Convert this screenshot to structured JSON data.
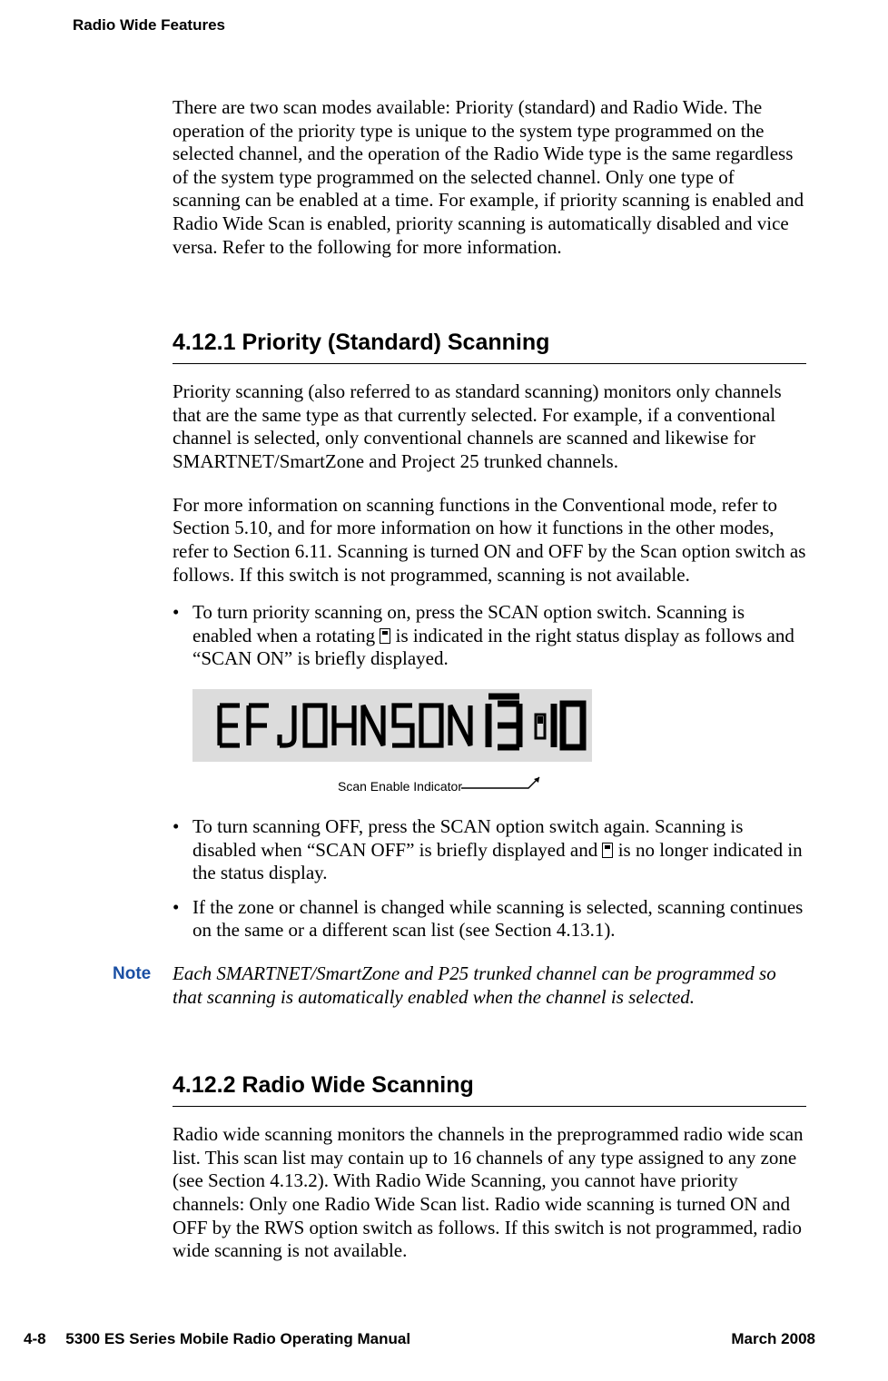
{
  "header": {
    "running": "Radio Wide Features"
  },
  "intro": {
    "p1": "There are two scan modes available: Priority (standard) and Radio Wide. The operation of the priority type is unique to the system type programmed on the selected channel, and the operation of the Radio Wide type is the same regardless of the system type programmed on the selected channel. Only one type of scanning can be enabled at a time. For example, if priority scanning is enabled and Radio Wide Scan is enabled, priority scanning is automatically disabled and vice versa. Refer to the following for more information."
  },
  "s4121": {
    "heading": "4.12.1   Priority (Standard) Scanning",
    "p1": "Priority scanning (also referred to as standard scanning) monitors only channels that are the same type as that currently selected. For example, if a conventional channel is selected, only conventional channels are scanned and likewise for SMARTNET/SmartZone and Project 25 trunked channels.",
    "p2": "For more information on scanning functions in the Conventional mode, refer to Section 5.10, and for more information on how it functions in the other modes, refer to Section 6.11. Scanning is turned ON and OFF by the Scan option switch as follows. If this switch is not programmed, scanning is not available.",
    "bullets": {
      "b1a": "To turn priority scanning on, press the SCAN option switch. Scanning is enabled when a rotating ",
      "b1b": " is indicated in the right status display as follows and “SCAN ON” is briefly displayed.",
      "b2a": "To turn scanning OFF, press the SCAN option switch again. Scanning is disabled when “SCAN OFF” is briefly displayed and ",
      "b2b": " is no longer indicated in the status display.",
      "b3": "If the zone or channel is changed while scanning is selected, scanning continues on the same or a different scan list (see Section 4.13.1)."
    },
    "figure": {
      "lcd_text": "EFJOHNSON 13 010",
      "caption": "Scan Enable Indicator"
    },
    "note": {
      "label": "Note",
      "text": "Each SMARTNET/SmartZone and P25 trunked channel can be programmed so that scanning is automatically enabled when the channel is selected."
    }
  },
  "s4122": {
    "heading": "4.12.2   Radio Wide Scanning",
    "p1": "Radio wide scanning monitors the channels in the preprogrammed radio wide scan list. This scan list may contain up to 16 channels of any type assigned to any zone (see Section 4.13.2). With Radio Wide Scanning, you cannot have priority channels: Only one Radio Wide Scan list. Radio wide scanning is turned ON and OFF by the RWS option switch as follows. If this switch is not programmed, radio wide scanning is not available."
  },
  "footer": {
    "left": "4-8  5300 ES Series Mobile Radio Operating Manual",
    "right": "March 2008"
  }
}
